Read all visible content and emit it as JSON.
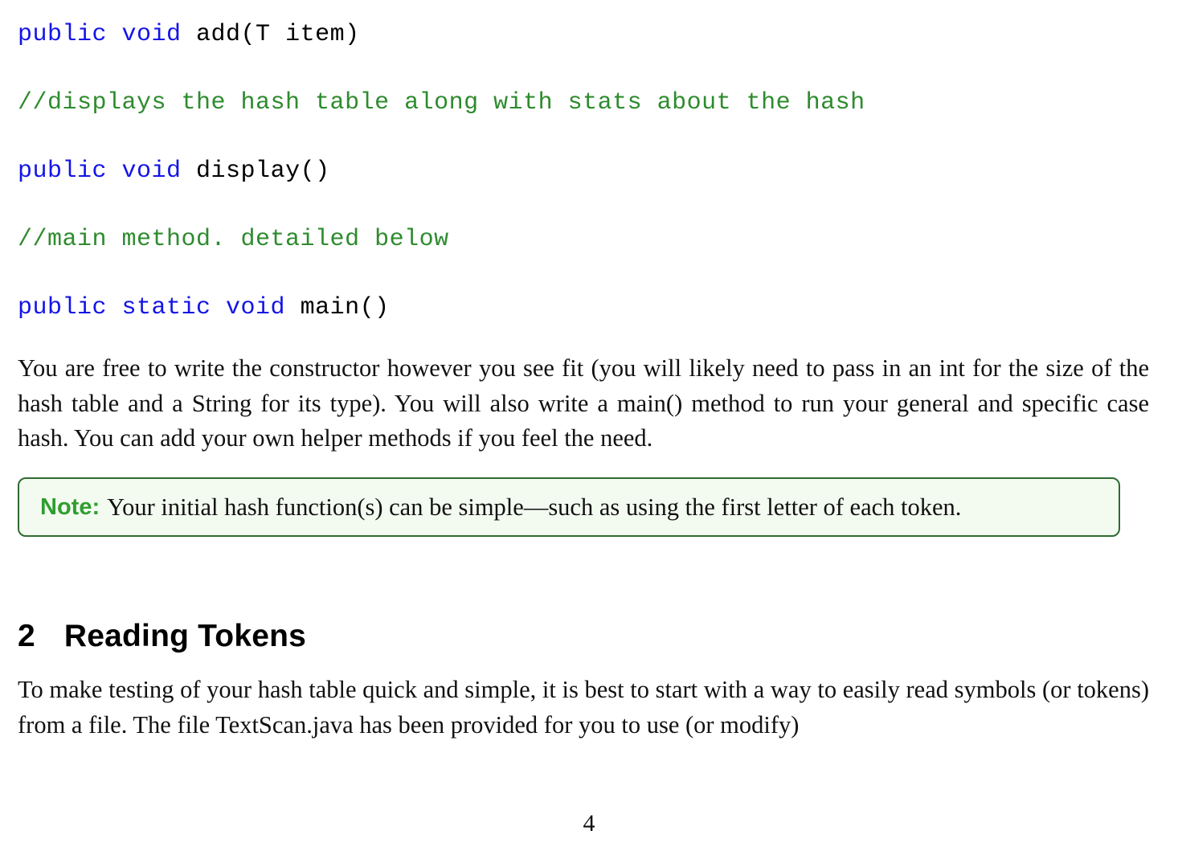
{
  "document": {
    "page_number": "4",
    "colors": {
      "keyword": "#1414e6",
      "comment": "#2e8b2e",
      "identifier": "#000000",
      "note_border": "#2f6b31",
      "note_background": "#f3faf0",
      "note_label": "#2f9e2f",
      "body_text": "#111111"
    }
  },
  "code": {
    "lines": [
      {
        "keyword": "public void",
        "identifier": " add(T item)",
        "comment": ""
      },
      {
        "keyword": "",
        "identifier": "",
        "comment": "//displays the hash table along with stats about the hash"
      },
      {
        "keyword": "public void",
        "identifier": " display()",
        "comment": ""
      },
      {
        "keyword": "",
        "identifier": "",
        "comment": "//main method. detailed below"
      },
      {
        "keyword": "public static void",
        "identifier": " main()",
        "comment": ""
      }
    ]
  },
  "paragraphs": {
    "constructor": "You are free to write the constructor however you see fit (you will likely need to pass in an int for the size of the hash table and a String for its type). You will also write a main() method to run your general and specific case hash. You can add your own helper methods if you feel the need.",
    "reading_tokens": "To make testing of your hash table quick and simple, it is best to start with a way to easily read symbols (or tokens) from a file. The file TextScan.java has been provided for you to use (or modify)"
  },
  "note": {
    "label": "Note:",
    "text": "Your initial hash function(s) can be simple—such as using the first letter of each token."
  },
  "section": {
    "number": "2",
    "title": "Reading Tokens"
  }
}
